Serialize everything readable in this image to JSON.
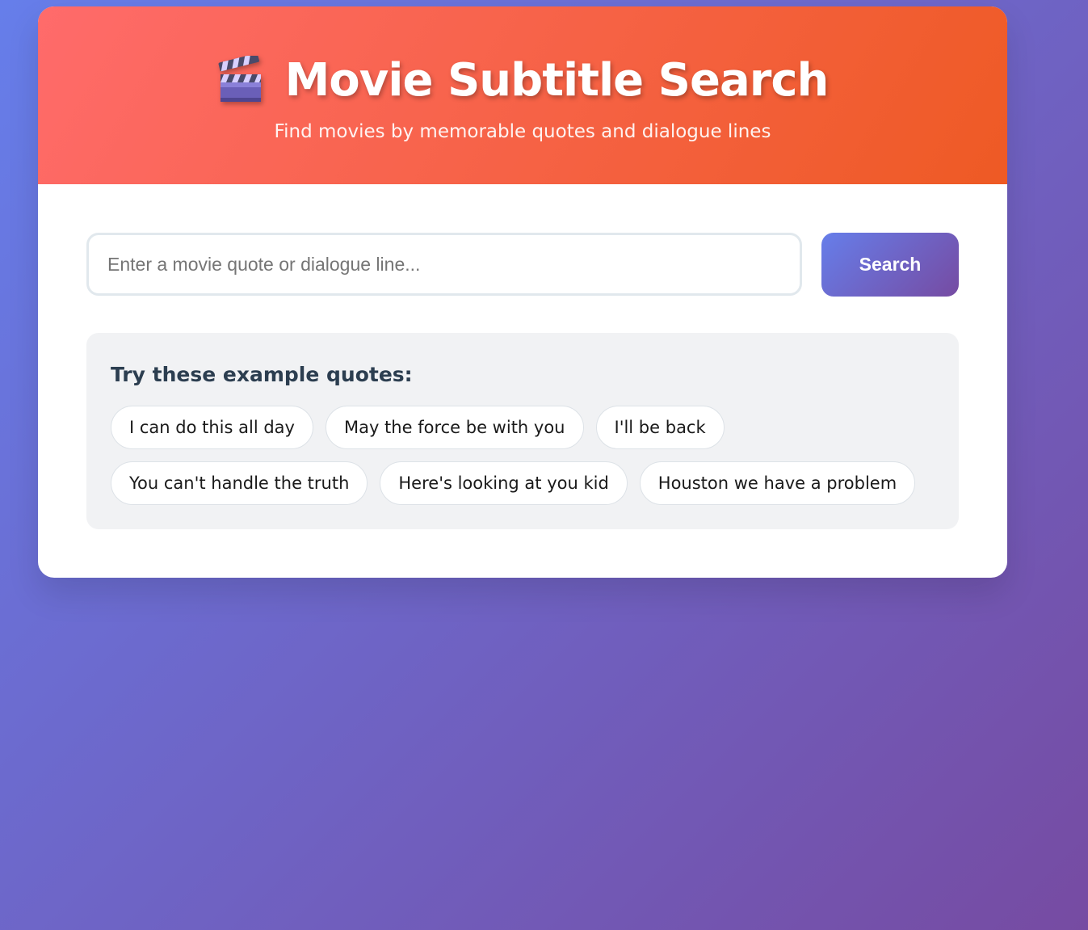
{
  "header": {
    "icon": "clapperboard-icon",
    "title": "Movie Subtitle Search",
    "subtitle": "Find movies by memorable quotes and dialogue lines"
  },
  "search": {
    "placeholder": "Enter a movie quote or dialogue line...",
    "value": "",
    "button_label": "Search"
  },
  "examples": {
    "title": "Try these example quotes:",
    "quotes": [
      "I can do this all day",
      "May the force be with you",
      "I'll be back",
      "You can't handle the truth",
      "Here's looking at you kid",
      "Houston we have a problem"
    ]
  },
  "colors": {
    "header_gradient_start": "#ff6b6b",
    "header_gradient_end": "#ee5a24",
    "page_gradient_start": "#667eea",
    "page_gradient_end": "#764ba2",
    "button_gradient_start": "#667eea",
    "button_gradient_end": "#764ba2"
  }
}
